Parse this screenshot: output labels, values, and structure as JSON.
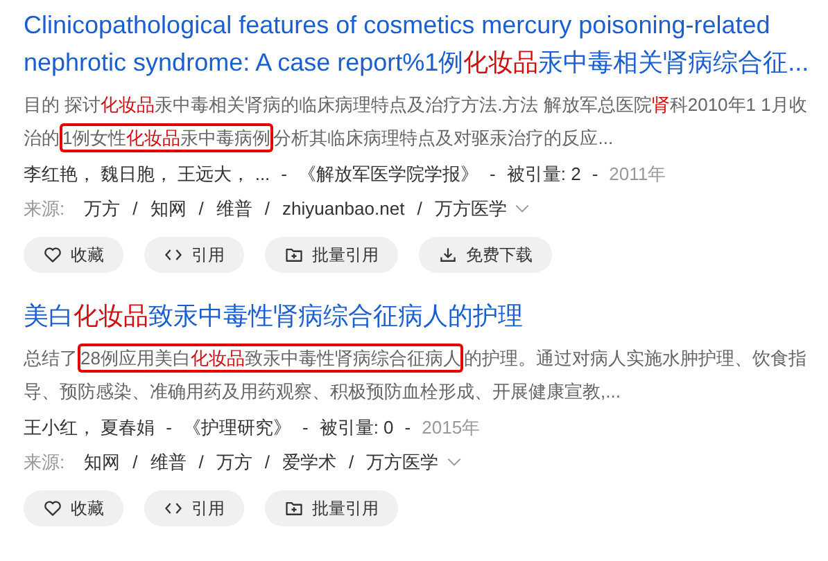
{
  "results": [
    {
      "title": [
        {
          "text": "Clinicopathological features of cosmetics mercury poisoning-related nephrotic syndrome: A case report%1例",
          "hit": false
        },
        {
          "text": "化妆品",
          "hit": true
        },
        {
          "text": "汞中毒相关肾病综合征...",
          "hit": false
        }
      ],
      "snippet": [
        {
          "text": "目的 探讨",
          "hit": false,
          "boxed": false
        },
        {
          "text": "化妆品",
          "hit": true,
          "boxed": false
        },
        {
          "text": "汞中毒相关肾病的临床病理特点及治疗方法.方法 解放军总医院",
          "hit": false,
          "boxed": false
        },
        {
          "text": "肾",
          "hit": true,
          "boxed": false
        },
        {
          "text": "科2010年1 1月收治的",
          "hit": false,
          "boxed": false
        },
        {
          "text": "1例女性",
          "hit": false,
          "boxed": true
        },
        {
          "text": "化妆品",
          "hit": true,
          "boxed": true
        },
        {
          "text": "汞中毒病例",
          "hit": false,
          "boxed": true
        },
        {
          "text": "分析其临床病理特点及对驱汞治疗的反应...",
          "hit": false,
          "boxed": false
        }
      ],
      "meta": {
        "authors": "李红艳， 魏日胞， 王远大， ...",
        "journal": "《解放军医学院学报》",
        "cited_label": "被引量:",
        "cited": "2",
        "year": "2011年",
        "separator": "-"
      },
      "sources": {
        "label": "来源:",
        "separator": "/",
        "items": [
          "万方",
          "知网",
          "维普",
          "zhiyuanbao.net",
          "万方医学"
        ]
      },
      "buttons": [
        {
          "label": "收藏",
          "kind": "heart"
        },
        {
          "label": "引用",
          "kind": "code"
        },
        {
          "label": "批量引用",
          "kind": "folder"
        },
        {
          "label": "免费下载",
          "kind": "download"
        }
      ]
    },
    {
      "title": [
        {
          "text": "美白",
          "hit": false
        },
        {
          "text": "化妆品",
          "hit": true
        },
        {
          "text": "致汞中毒性肾病综合征病人的护理",
          "hit": false
        }
      ],
      "snippet": [
        {
          "text": "总结了",
          "hit": false,
          "boxed": false
        },
        {
          "text": "28例应用美白",
          "hit": false,
          "boxed": true
        },
        {
          "text": "化妆品",
          "hit": true,
          "boxed": true
        },
        {
          "text": "致汞中毒性肾病综合征病人",
          "hit": false,
          "boxed": true
        },
        {
          "text": "的护理。通过对病人实施水肿护理、饮食指导、预防感染、准确用药及用药观察、积极预防血栓形成、开展健康宣教,...",
          "hit": false,
          "boxed": false
        }
      ],
      "meta": {
        "authors": "王小红， 夏春娟",
        "journal": "《护理研究》",
        "cited_label": "被引量:",
        "cited": "0",
        "year": "2015年",
        "separator": "-"
      },
      "sources": {
        "label": "来源:",
        "separator": "/",
        "items": [
          "知网",
          "维普",
          "万方",
          "爱学术",
          "万方医学"
        ]
      },
      "buttons": [
        {
          "label": "收藏",
          "kind": "heart"
        },
        {
          "label": "引用",
          "kind": "code"
        },
        {
          "label": "批量引用",
          "kind": "folder"
        }
      ]
    }
  ]
}
